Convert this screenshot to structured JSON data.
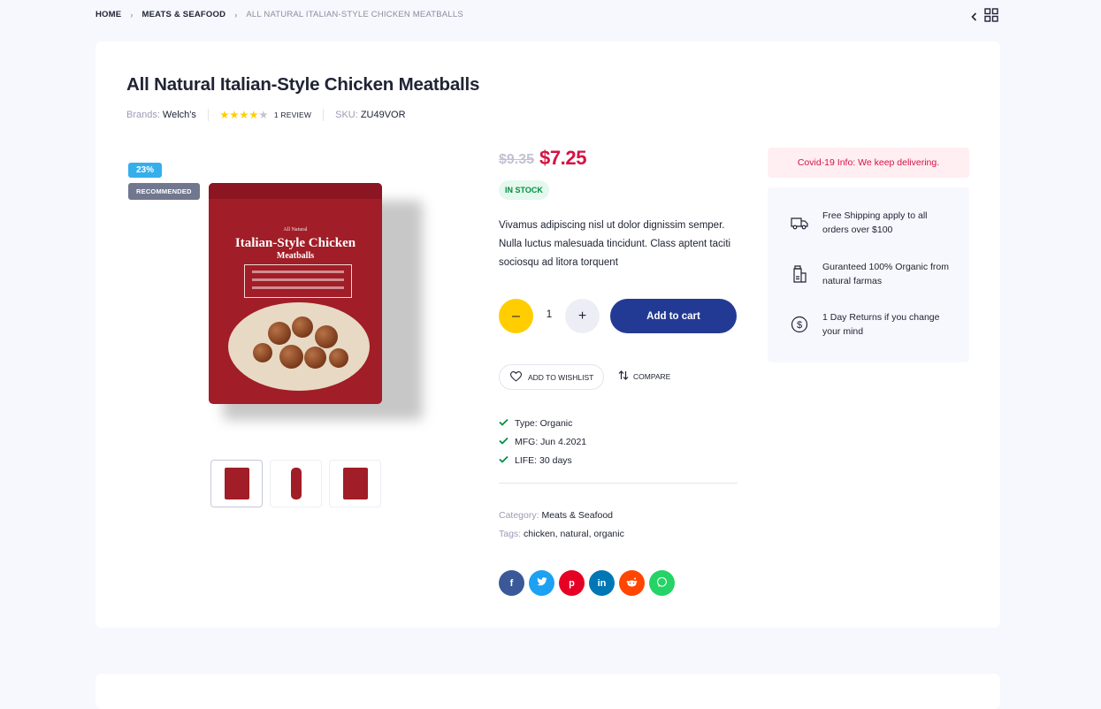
{
  "breadcrumb": {
    "home": "HOME",
    "category": "MEATS & SEAFOOD",
    "current": "ALL NATURAL ITALIAN-STYLE CHICKEN MEATBALLS"
  },
  "product": {
    "title": "All Natural Italian-Style Chicken Meatballs",
    "brand_label": "Brands:",
    "brand": "Welch's",
    "rating": 4,
    "rating_max": 5,
    "review_count": "1 REVIEW",
    "sku_label": "SKU:",
    "sku": "ZU49VOR",
    "discount_badge": "23%",
    "recommended_badge": "RECOMMENDED",
    "package": {
      "pre_title": "All Natural",
      "title": "Italian-Style Chicken",
      "subtitle": "Meatballs"
    },
    "price_old": "$9.35",
    "price_new": "$7.25",
    "stock": "IN STOCK",
    "description": "Vivamus adipiscing nisl ut dolor dignissim semper. Nulla luctus malesuada tincidunt. Class aptent taciti sociosqu ad litora torquent",
    "quantity": "1",
    "add_to_cart": "Add to cart",
    "wishlist": "ADD TO WISHLIST",
    "compare": "COMPARE",
    "specs": [
      "Type: Organic",
      "MFG: Jun 4.2021",
      "LIFE: 30 days"
    ],
    "category_label": "Category:",
    "category": "Meats & Seafood",
    "tags_label": "Tags:",
    "tags": "chicken, natural, organic"
  },
  "socials": [
    {
      "name": "facebook",
      "glyph": "f",
      "color": "#3b5998"
    },
    {
      "name": "twitter",
      "glyph": "t",
      "color": "#1da1f2"
    },
    {
      "name": "pinterest",
      "glyph": "p",
      "color": "#e60023"
    },
    {
      "name": "linkedin",
      "glyph": "in",
      "color": "#0077b5"
    },
    {
      "name": "reddit",
      "glyph": "r",
      "color": "#ff4500"
    },
    {
      "name": "whatsapp",
      "glyph": "w",
      "color": "#25d366"
    }
  ],
  "sidebar": {
    "covid": "Covid-19 Info: We keep delivering.",
    "items": [
      {
        "icon": "truck-icon",
        "text": "Free Shipping apply to all orders over $100"
      },
      {
        "icon": "organic-product-icon",
        "text": "Guranteed 100% Organic from natural farmas"
      },
      {
        "icon": "dollar-icon",
        "text": "1 Day Returns if you change your mind"
      }
    ]
  },
  "colors": {
    "accent": "#233a95",
    "price": "#d51243",
    "stock": "#038e42",
    "star": "#ffcd00"
  }
}
